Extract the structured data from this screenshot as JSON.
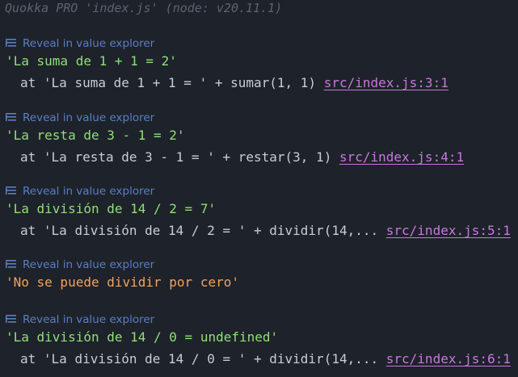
{
  "header": {
    "title": "Quokka PRO 'index.js' (node: v20.11.1)"
  },
  "entries": [
    {
      "reveal_label": "Reveal in value explorer",
      "value": "'La suma de 1 + 1 = 2'",
      "trace_prefix": "at ",
      "trace_expr": "'La suma de 1 + 1 = ' + sumar(1, 1)",
      "trace_link": "src/index.js:3:1"
    },
    {
      "reveal_label": "Reveal in value explorer",
      "value": "'La resta de 3 - 1 = 2'",
      "trace_prefix": "at ",
      "trace_expr": "'La resta de 3 - 1 = ' + restar(3, 1)",
      "trace_link": "src/index.js:4:1"
    },
    {
      "reveal_label": "Reveal in value explorer",
      "value": "'La división de 14 / 2 = 7'",
      "trace_prefix": "at ",
      "trace_expr": "'La división de 14 / 2 = ' + dividir(14,...",
      "trace_link": "src/index.js:5:1"
    },
    {
      "reveal_label": "Reveal in value explorer",
      "value": "'No se puede dividir por cero'"
    },
    {
      "reveal_label": "Reveal in value explorer",
      "value": "'La división de 14 / 0 = undefined'",
      "trace_prefix": "at ",
      "trace_expr": "'La división de 14 / 0 = ' + dividir(14,...",
      "trace_link": "src/index.js:6:1"
    }
  ],
  "icons": {
    "reveal": "list-tree-icon"
  },
  "colors": {
    "background": "#1e222a",
    "header": "#5c6370",
    "reveal": "#5a7fc4",
    "log_value": "#8fe07a",
    "warn_value": "#f0a35e",
    "trace_text": "#c8ccd4",
    "link": "#c678dd"
  }
}
